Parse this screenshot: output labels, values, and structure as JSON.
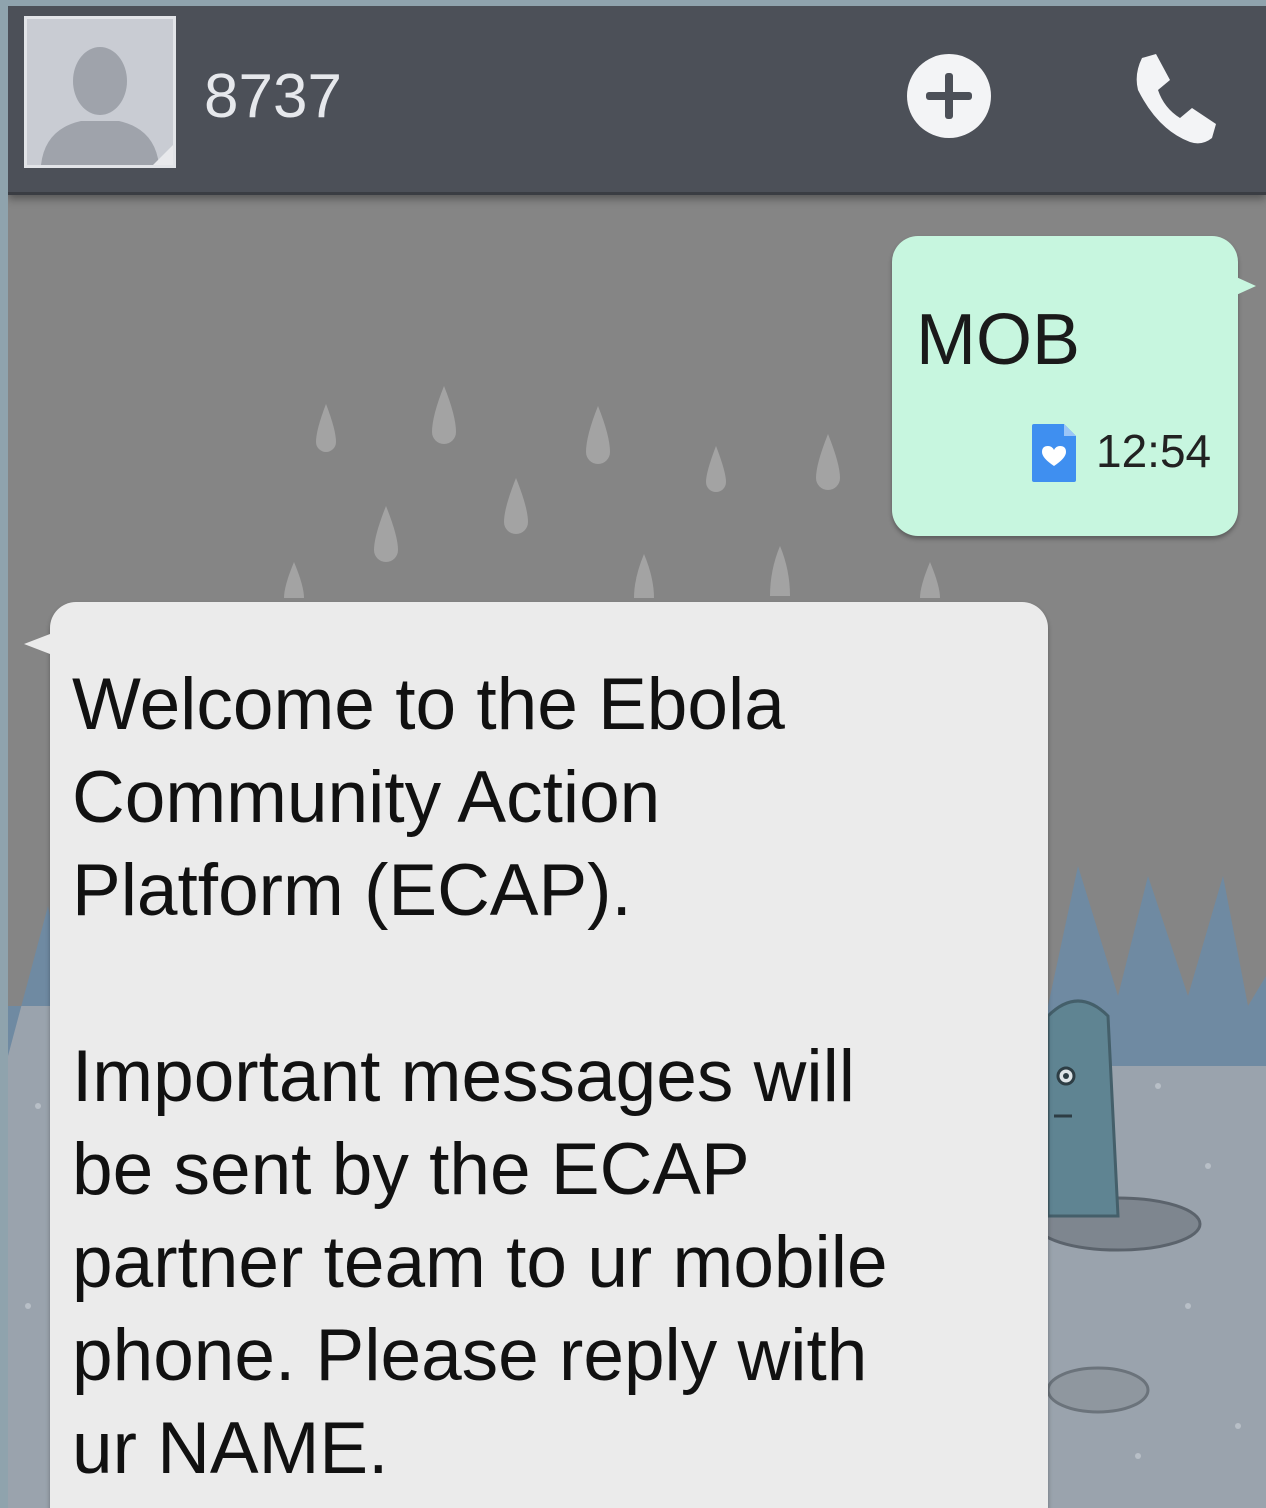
{
  "header": {
    "contact": "8737",
    "add_icon": "plus-circle-icon",
    "call_icon": "phone-icon",
    "avatar_icon": "default-contact-silhouette"
  },
  "messages": [
    {
      "direction": "sent",
      "text": "MOB",
      "time": "12:54",
      "status_icon": "sms-delivered-icon"
    },
    {
      "direction": "received",
      "text": "Welcome to the Ebola\nCommunity Action\nPlatform (ECAP).\n\nImportant messages will\nbe sent by the ECAP\npartner team to ur mobile\nphone. Please reply with\nur NAME."
    }
  ],
  "colors": {
    "header_bg": "#4c5058",
    "sent_bubble": "#c7f6df",
    "received_bubble": "#ebebeb",
    "wallpaper": "#848484"
  }
}
